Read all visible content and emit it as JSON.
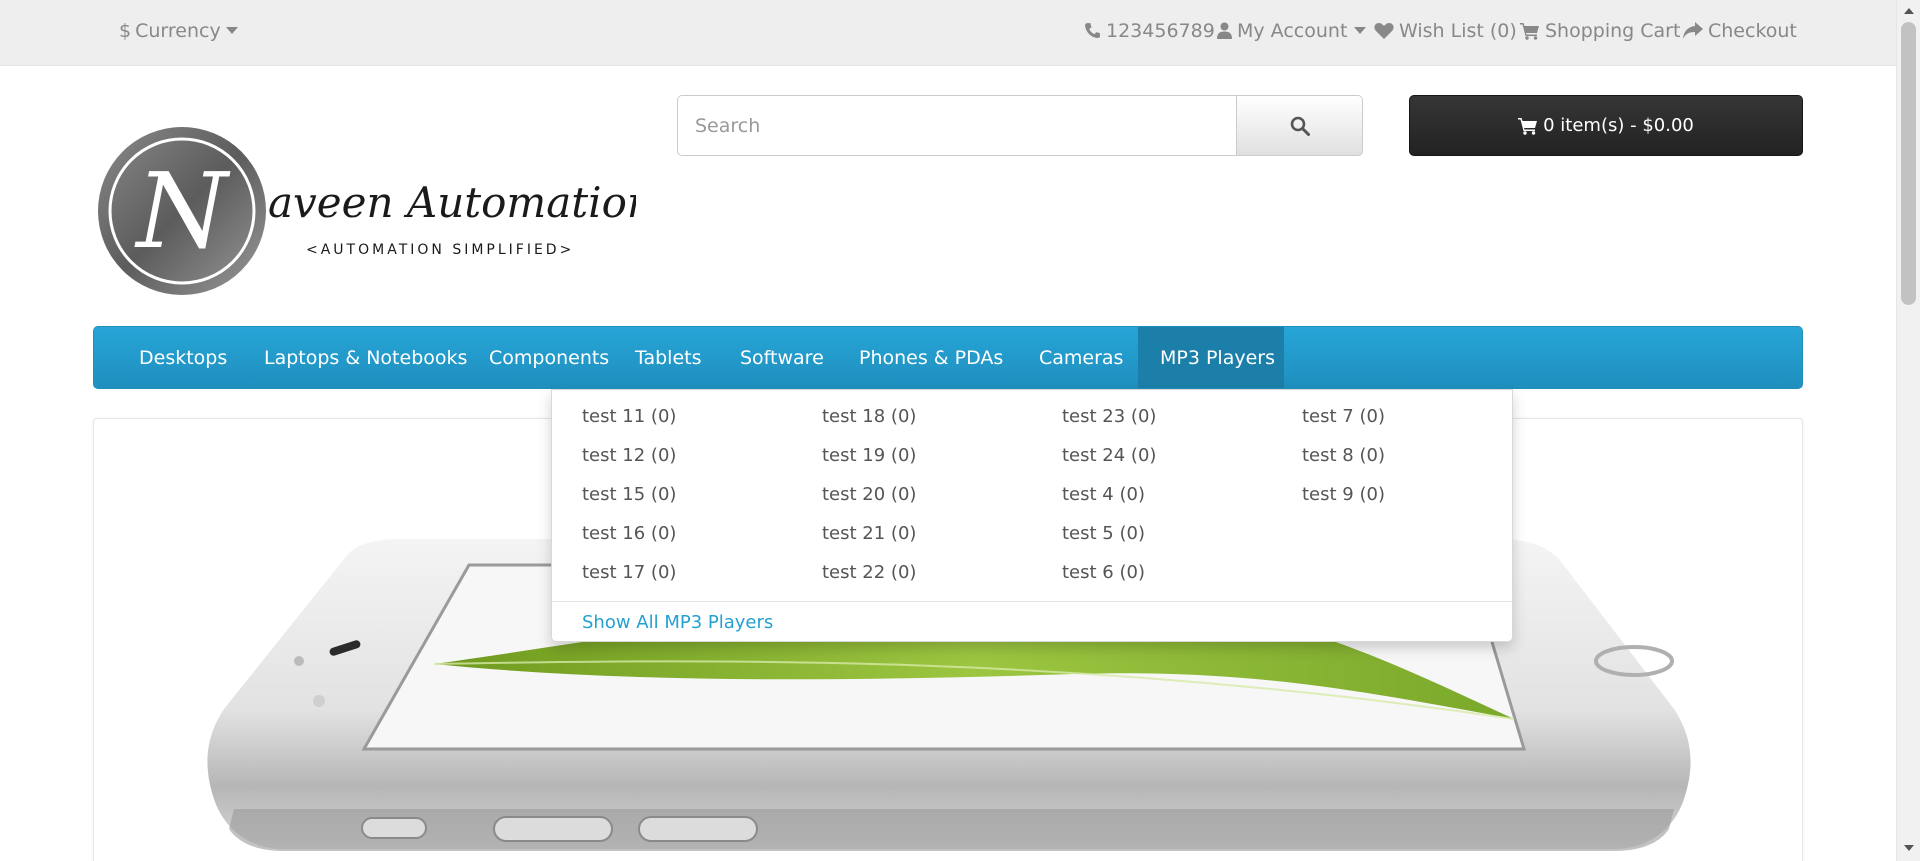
{
  "topbar": {
    "currency_label": "Currency",
    "phone": "123456789",
    "my_account": "My Account",
    "wish_list": "Wish List (0)",
    "shopping_cart": "Shopping Cart",
    "checkout": "Checkout"
  },
  "logo": {
    "title": "aveen Automation Labs",
    "initial": "N",
    "tagline": "<AUTOMATION SIMPLIFIED>"
  },
  "search": {
    "placeholder": "Search",
    "value": ""
  },
  "cart": {
    "label": "0 item(s) - $0.00"
  },
  "nav": {
    "items": [
      "Desktops",
      "Laptops & Notebooks",
      "Components",
      "Tablets",
      "Software",
      "Phones & PDAs",
      "Cameras",
      "MP3 Players"
    ],
    "active_index": 7
  },
  "dropdown": {
    "columns": [
      [
        "test 11 (0)",
        "test 12 (0)",
        "test 15 (0)",
        "test 16 (0)",
        "test 17 (0)"
      ],
      [
        "test 18 (0)",
        "test 19 (0)",
        "test 20 (0)",
        "test 21 (0)",
        "test 22 (0)"
      ],
      [
        "test 23 (0)",
        "test 24 (0)",
        "test 4 (0)",
        "test 5 (0)",
        "test 6 (0)"
      ],
      [
        "test 7 (0)",
        "test 8 (0)",
        "test 9 (0)"
      ]
    ],
    "show_all": "Show All MP3 Players"
  },
  "colors": {
    "menu_blue": "#229ac8",
    "link_blue": "#23a1d1",
    "cart_dark": "#303030"
  }
}
